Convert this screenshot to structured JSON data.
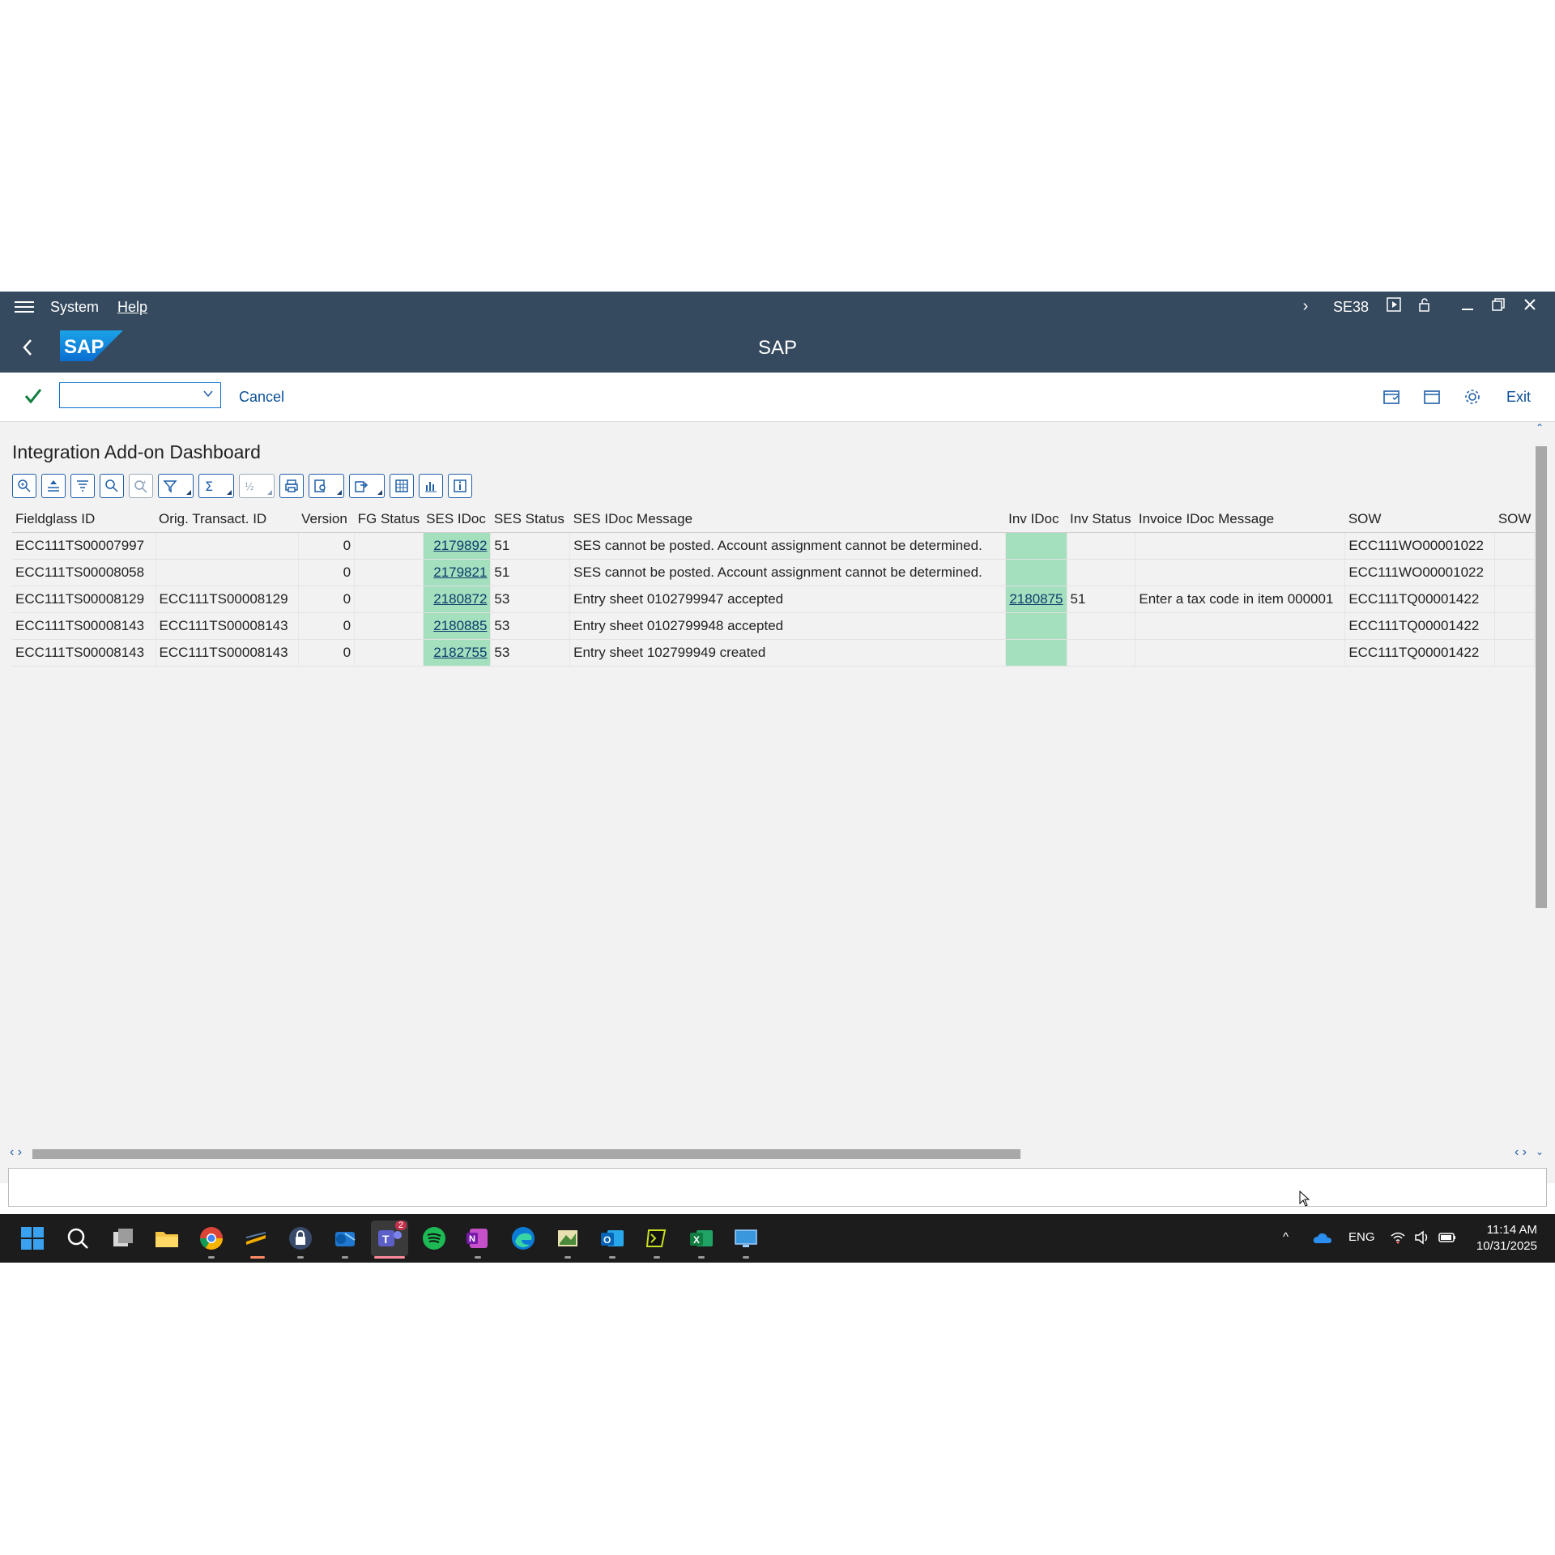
{
  "menubar": {
    "items": [
      "System",
      "Help"
    ],
    "tcode": "SE38"
  },
  "titlebar": {
    "title": "SAP"
  },
  "toolbar": {
    "command_value": "",
    "cancel_label": "Cancel",
    "exit_label": "Exit"
  },
  "page": {
    "title": "Integration Add-on Dashboard"
  },
  "grid": {
    "columns": [
      "Fieldglass ID",
      "Orig. Transact. ID",
      "Version",
      "FG Status",
      "SES IDoc",
      "SES Status",
      "SES IDoc Message",
      "Inv IDoc",
      "Inv Status",
      "Invoice IDoc Message",
      "SOW",
      "SOW"
    ],
    "rows": [
      [
        "ECC111TS00007997",
        "",
        "0",
        "",
        "2179892",
        "51",
        "SES cannot be posted. Account assignment cannot be determined.",
        "",
        "",
        "",
        "ECC111WO00001022",
        ""
      ],
      [
        "ECC111TS00008058",
        "",
        "0",
        "",
        "2179821",
        "51",
        "SES cannot be posted. Account assignment cannot be determined.",
        "",
        "",
        "",
        "ECC111WO00001022",
        ""
      ],
      [
        "ECC111TS00008129",
        "ECC111TS00008129",
        "0",
        "",
        "2180872",
        "53",
        "Entry sheet 0102799947 accepted",
        "2180875",
        "51",
        "Enter a tax code in item 000001",
        "ECC111TQ00001422",
        ""
      ],
      [
        "ECC111TS00008143",
        "ECC111TS00008143",
        "0",
        "",
        "2180885",
        "53",
        "Entry sheet 0102799948 accepted",
        "",
        "",
        "",
        "ECC111TQ00001422",
        ""
      ],
      [
        "ECC111TS00008143",
        "ECC111TS00008143",
        "0",
        "",
        "2182755",
        "53",
        "Entry sheet 102799949 created",
        "",
        "",
        "",
        "ECC111TQ00001422",
        ""
      ]
    ]
  },
  "taskbar": {
    "teams_badge": "2",
    "lang": "ENG",
    "time": "11:14 AM",
    "date": "10/31/2025"
  },
  "colors": {
    "shell": "#354a5f",
    "highlight_cell": "#a4dfbe",
    "link": "#0a4f96"
  }
}
